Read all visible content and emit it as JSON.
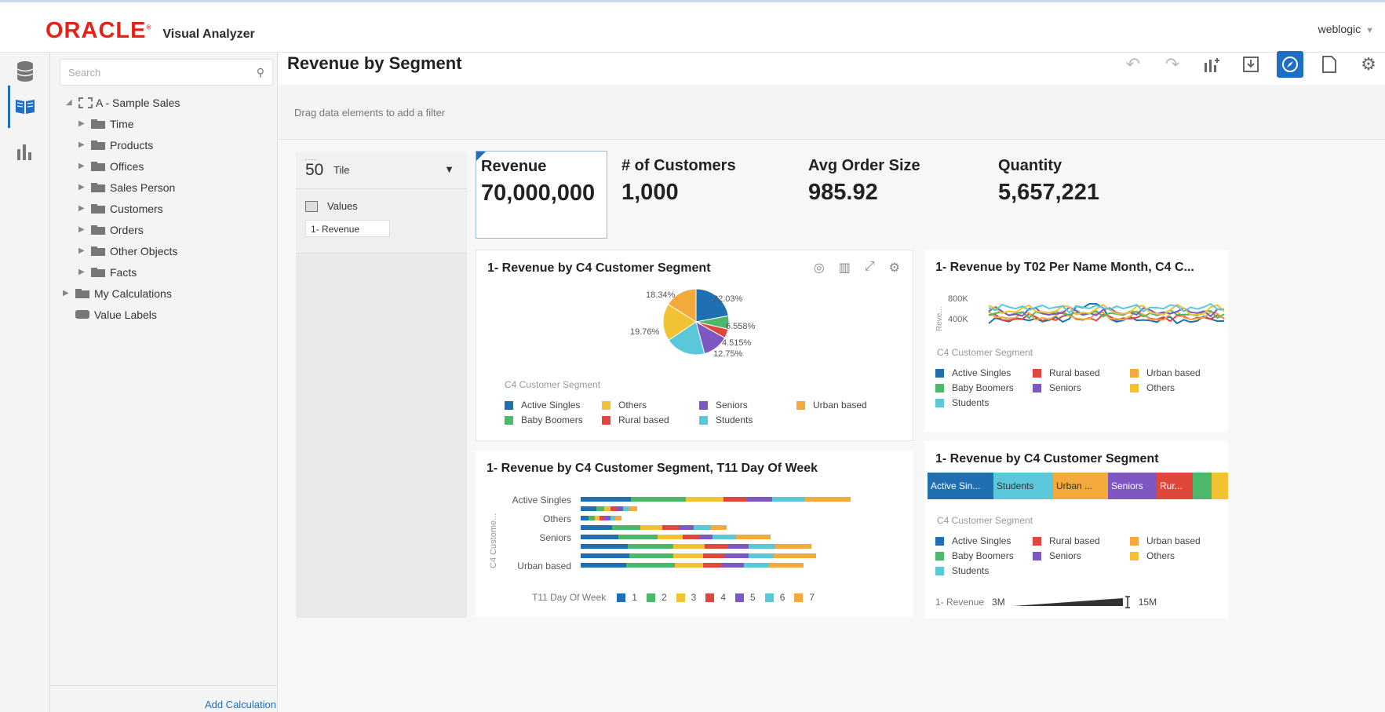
{
  "header": {
    "brand": "ORACLE",
    "app_name": "Visual Analyzer",
    "user": "weblogic"
  },
  "data_panel": {
    "search_placeholder": "Search",
    "tree": {
      "root": "A - Sample Sales",
      "folders": [
        "Time",
        "Products",
        "Offices",
        "Sales Person",
        "Customers",
        "Orders",
        "Other Objects",
        "Facts"
      ],
      "my_calculations": "My Calculations",
      "value_labels": "Value Labels"
    },
    "add_calculation": "Add Calculation"
  },
  "canvas": {
    "title": "Revenue by Segment",
    "filter_hint": "Drag data elements to add a filter"
  },
  "grammar": {
    "type_label": "Tile",
    "type_number": "50",
    "section": "Values",
    "pill": "1- Revenue"
  },
  "kpis": [
    {
      "label": "Revenue",
      "value": "70,000,000"
    },
    {
      "label": "# of Customers",
      "value": "1,000"
    },
    {
      "label": "Avg Order Size",
      "value": "985.92"
    },
    {
      "label": "Quantity",
      "value": "5,657,221"
    }
  ],
  "colors": {
    "Active Singles": "#1f6fb2",
    "Baby Boomers": "#4cb86b",
    "Others": "#f1c232",
    "Rural based": "#e0473c",
    "Seniors": "#7e57c2",
    "Students": "#5bc8d9",
    "Urban based": "#f4a93c"
  },
  "pie_card": {
    "title": "1- Revenue by C4 Customer Segment",
    "legend_title": "C4 Customer Segment",
    "legend": [
      "Active Singles",
      "Others",
      "Seniors",
      "Urban based",
      "Baby Boomers",
      "Rural based",
      "Students"
    ],
    "labels": [
      "22.03%",
      "6.558%",
      "4.515%",
      "12.75%",
      "19.76%",
      "18.34%"
    ]
  },
  "line_card": {
    "title": "1- Revenue by T02 Per Name Month, C4 C...",
    "axis_label": "Reve...",
    "ticks": [
      "800K",
      "400K"
    ],
    "legend_title": "C4 Customer Segment",
    "legend": [
      "Active Singles",
      "Rural based",
      "Urban based",
      "Baby Boomers",
      "Seniors",
      "Others",
      "Students"
    ]
  },
  "bar_card": {
    "title": "1- Revenue by C4 Customer Segment, T11 Day Of Week",
    "axis_label": "C4 Custome...",
    "categories": [
      "Active Singles",
      "Others",
      "Seniors",
      "Urban based"
    ],
    "legend_title": "T11 Day Of Week",
    "legend": [
      "1",
      "2",
      "3",
      "4",
      "5",
      "6",
      "7"
    ]
  },
  "stack_card": {
    "title": "1- Revenue by C4 Customer Segment",
    "segments": [
      {
        "label": "Active Sin...",
        "color": "#1f6fb2"
      },
      {
        "label": "Students",
        "color": "#5bc8d9"
      },
      {
        "label": "Urban ...",
        "color": "#f4a93c"
      },
      {
        "label": "Seniors",
        "color": "#7e57c2"
      },
      {
        "label": "Rur...",
        "color": "#e0473c"
      },
      {
        "label": "",
        "color": "#4cb86b"
      },
      {
        "label": "",
        "color": "#f1c232"
      }
    ],
    "legend_title": "C4 Customer Segment",
    "legend": [
      "Active Singles",
      "Rural based",
      "Urban based",
      "Baby Boomers",
      "Seniors",
      "Others",
      "Students"
    ],
    "size_label": "1- Revenue",
    "size_min": "3M",
    "size_max": "15M"
  }
}
